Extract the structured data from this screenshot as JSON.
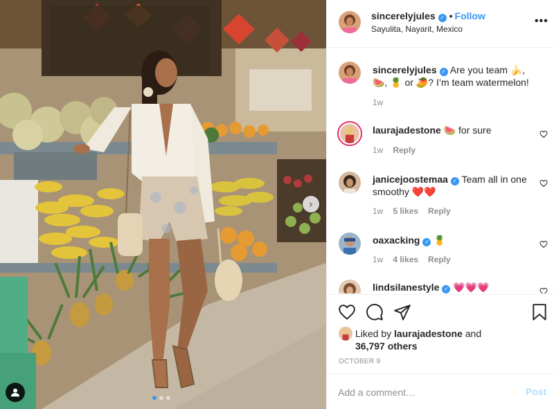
{
  "post": {
    "author": "sincerelyjules",
    "verified": true,
    "separator": "•",
    "follow_label": "Follow",
    "location": "Sayulita, Nayarit, Mexico",
    "more_icon": "more-horizontal-icon",
    "more_label": "•••"
  },
  "photo": {
    "next_arrow": "›",
    "slide_count": 3,
    "active_slide": 1,
    "tag_icon": "user-tag-icon"
  },
  "caption": {
    "username": "sincerelyjules",
    "text": "Are you team 🍌, 🍉, 🍍 or 🥭? I’m team watermelon!",
    "time": "1w"
  },
  "comments": [
    {
      "username": "laurajadestone",
      "text": "🍉 for sure",
      "time": "1w",
      "likes": "",
      "reply": "Reply",
      "verified": false
    },
    {
      "username": "janicejoostemaa",
      "text": "Team all in one smoothy ❤️❤️",
      "time": "1w",
      "likes": "5 likes",
      "reply": "Reply",
      "verified": true
    },
    {
      "username": "oaxacking",
      "text": "🍍",
      "time": "1w",
      "likes": "4 likes",
      "reply": "Reply",
      "verified": true
    },
    {
      "username": "lindsilanestyle",
      "text": "💗💗💗",
      "time": "",
      "likes": "",
      "reply": "",
      "verified": true
    }
  ],
  "actions": {
    "like_icon": "heart-icon",
    "comment_icon": "comment-icon",
    "share_icon": "share-icon",
    "save_icon": "bookmark-icon"
  },
  "likes": {
    "prefix": "Liked by",
    "user": "laurajadestone",
    "and": "and",
    "others": "36,797 others"
  },
  "date": "OCTOBER 9",
  "add_comment": {
    "placeholder": "Add a comment…",
    "post_label": "Post"
  },
  "colors": {
    "accent": "#3897f0",
    "post_disabled": "#b2dffc",
    "muted": "#8e8e8e",
    "text": "#262626",
    "like_red": "#ed4956"
  }
}
